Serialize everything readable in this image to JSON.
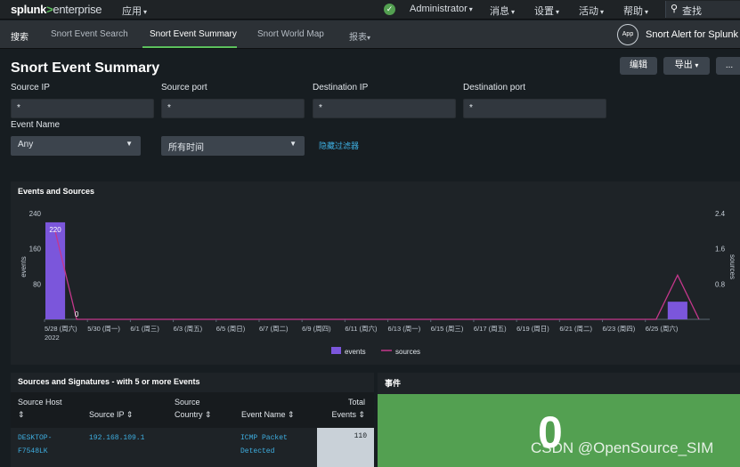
{
  "topbar": {
    "logo_splunk": "splunk",
    "logo_gt": ">",
    "logo_enterprise": "enterprise",
    "apps": "应用",
    "user": "Administrator",
    "messages": "消息",
    "settings": "设置",
    "activity": "活动",
    "help": "帮助",
    "search": "查找"
  },
  "appbar": {
    "tabs": [
      "搜索",
      "Snort Event Search",
      "Snort Event Summary",
      "Snort World Map",
      "报表"
    ],
    "app_badge": "App",
    "app_name": "Snort Alert for Splunk"
  },
  "dashboard": {
    "title": "Snort Event Summary",
    "edit_label": "编辑",
    "export_label": "导出",
    "more_label": "..."
  },
  "filters": {
    "source_ip": {
      "label": "Source IP",
      "value": "*"
    },
    "source_port": {
      "label": "Source port",
      "value": "*"
    },
    "dest_ip": {
      "label": "Destination IP",
      "value": "*"
    },
    "dest_port": {
      "label": "Destination port",
      "value": "*"
    },
    "event_name": {
      "label": "Event Name",
      "value": "Any"
    },
    "time_range": {
      "value": "所有时间"
    },
    "hide_filters": "隐藏过滤器"
  },
  "chart_panel": {
    "title": "Events and Sources"
  },
  "chart_data": {
    "type": "bar",
    "title": "Events and Sources",
    "ylabel": "events",
    "y2label": "sources",
    "ylim": [
      0,
      240
    ],
    "y2lim": [
      0,
      2.4
    ],
    "yticks": [
      "240",
      "160",
      "80"
    ],
    "y2ticks": [
      "2.4",
      "1.6",
      "0.8"
    ],
    "categories": [
      "5/28 (周六)\n2022",
      "5/30 (周一)",
      "6/1 (周三)",
      "6/3 (周五)",
      "6/5 (周日)",
      "6/7 (周二)",
      "6/9 (周四)",
      "6/11 (周六)",
      "6/13 (周一)",
      "6/15 (周三)",
      "6/17 (周五)",
      "6/19 (周日)",
      "6/21 (周二)",
      "6/23 (周四)",
      "6/25 (周六)"
    ],
    "series": [
      {
        "name": "events",
        "type": "bar",
        "color": "#7b56db",
        "values": [
          220,
          0,
          0,
          0,
          0,
          0,
          0,
          0,
          0,
          0,
          0,
          0,
          0,
          0,
          0,
          0,
          0,
          0,
          0,
          0,
          0,
          0,
          0,
          0,
          0,
          0,
          0,
          0,
          0,
          40,
          0
        ]
      },
      {
        "name": "sources",
        "type": "line",
        "color": "#c5378c",
        "values": [
          2,
          0,
          0,
          0,
          0,
          0,
          0,
          0,
          0,
          0,
          0,
          0,
          0,
          0,
          0,
          0,
          0,
          0,
          0,
          0,
          0,
          0,
          0,
          0,
          0,
          0,
          0,
          0,
          0,
          1,
          0
        ]
      }
    ],
    "data_labels": [
      "220",
      "0"
    ],
    "legend": "bottom",
    "grid": false
  },
  "table_panel": {
    "title": "Sources and Signatures - with 5 or more Events",
    "columns": [
      "Source Host",
      "Source IP",
      "Source Country",
      "Event Name",
      "Total Events"
    ],
    "rows": [
      {
        "host_line1": "DESKTOP-",
        "host_line2": "F7548LK",
        "ip": "192.168.109.1",
        "country": "",
        "event_line1": "ICMP Packet",
        "event_line2": "Detected",
        "total": "110"
      }
    ]
  },
  "events_panel": {
    "title": "事件",
    "value": "0"
  },
  "watermark": "CSDN @OpenSource_SIM"
}
